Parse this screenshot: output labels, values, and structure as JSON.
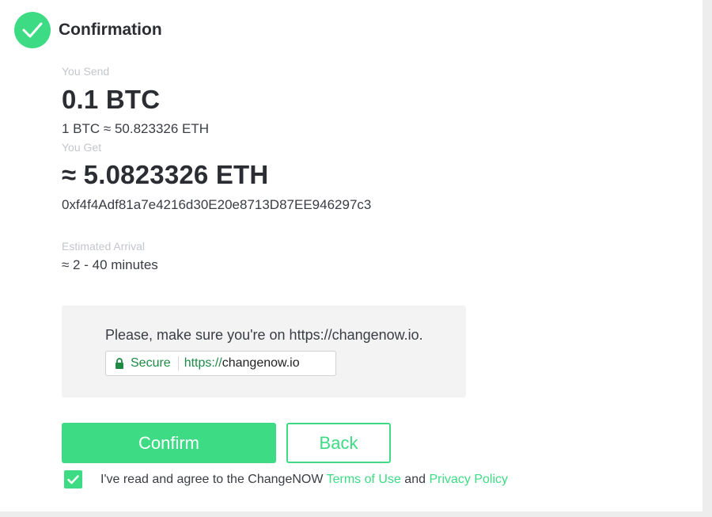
{
  "header": {
    "title": "Confirmation",
    "check_icon": "checkmark-icon"
  },
  "send": {
    "label": "You Send",
    "amount": "0.1 BTC",
    "rate": "1 BTC  ≈ 50.823326 ETH"
  },
  "get": {
    "label": "You Get",
    "amount": "≈ 5.0823326 ETH",
    "address": "0xf4f4Adf81a7e4216d30E20e8713D87EE946297c3"
  },
  "arrival": {
    "label": "Estimated Arrival",
    "value": "≈ 2 - 40 minutes"
  },
  "notice": {
    "text": "Please, make sure you're on https://changenow.io.",
    "secure_label": "Secure",
    "url_scheme": "https://",
    "url_domain": "changenow.io",
    "lock_icon": "lock-icon"
  },
  "actions": {
    "confirm_label": "Confirm",
    "back_label": "Back"
  },
  "agreement": {
    "checked": true,
    "prefix": "I've read and agree to the ChangeNOW ",
    "terms_label": "Terms of Use",
    "joiner": " and ",
    "privacy_label": "Privacy Policy"
  },
  "colors": {
    "accent": "#3ddc84",
    "secure_green": "#1e8a46",
    "muted_label": "#c3c6cc"
  }
}
